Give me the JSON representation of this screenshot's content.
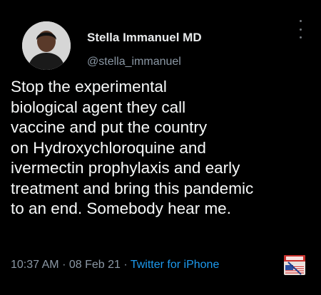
{
  "author": {
    "display_name": "Stella Immanuel MD",
    "handle": "@stella_immanuel"
  },
  "tweet": {
    "text": "Stop the experimental\nbiological agent they call\nvaccine and put the country\non Hydroxychloroquine and\nivermectin prophylaxis and early\ntreatment and bring this pandemic\nto an end. Somebody hear me.",
    "time": "10:37 AM",
    "date": "08 Feb 21",
    "source": "Twitter for iPhone"
  },
  "icons": {
    "more": "more-icon",
    "badge": "flag-badge-icon"
  },
  "colors": {
    "background": "#000000",
    "text": "#f7f9f9",
    "muted": "#8b98a5",
    "link": "#1d9bf0"
  }
}
